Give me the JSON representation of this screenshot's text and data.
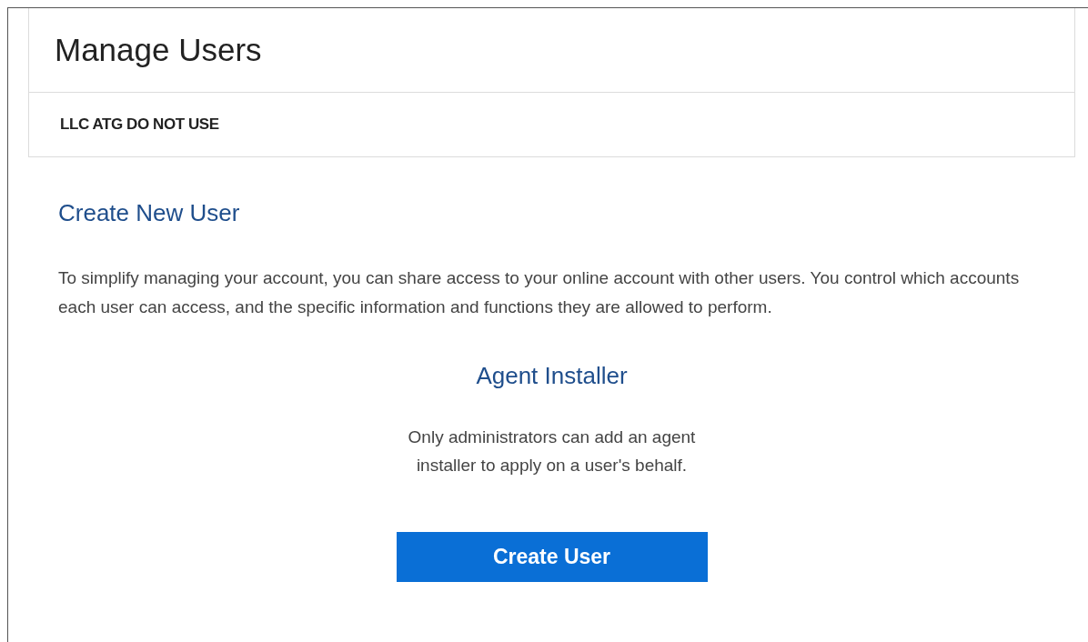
{
  "header": {
    "title": "Manage Users",
    "account": "LLC ATG DO NOT USE"
  },
  "section": {
    "title": "Create New User",
    "description": "To simplify managing your account, you can share access to your online account with other users. You control which accounts each user can access, and the specific information and functions they are allowed to perform."
  },
  "agent": {
    "title": "Agent Installer",
    "note": "Only administrators can add an agent installer to apply on a user's behalf.",
    "button": "Create User"
  }
}
